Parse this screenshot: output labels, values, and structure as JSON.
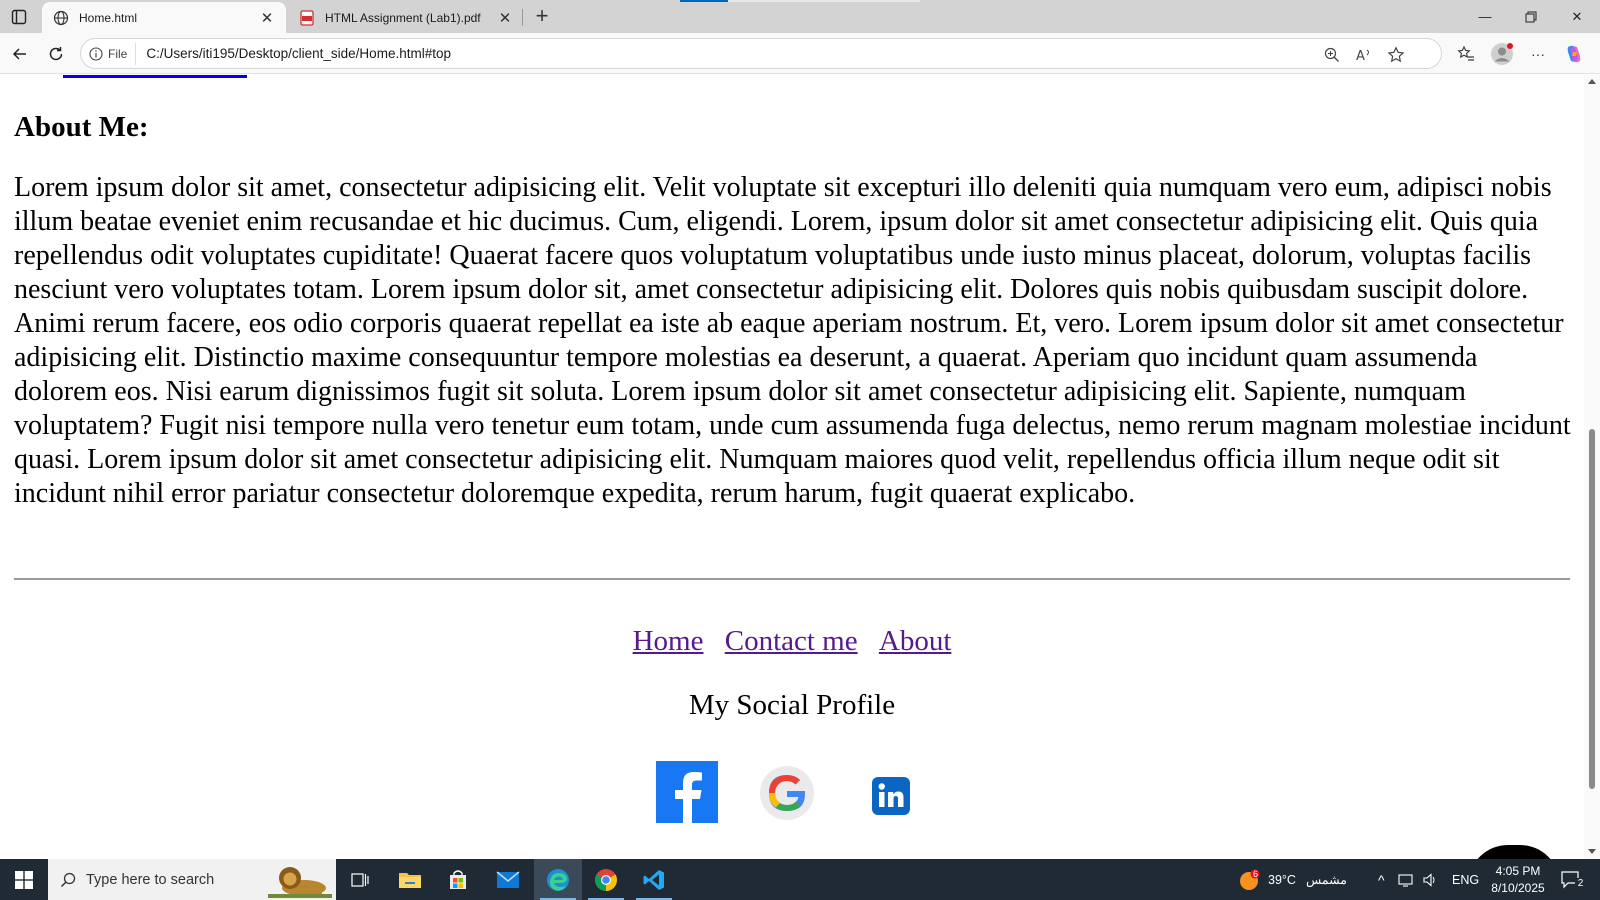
{
  "browser": {
    "tabs": [
      {
        "title": "Home.html",
        "active": true,
        "icon": "globe-icon"
      },
      {
        "title": "HTML Assignment (Lab1).pdf",
        "active": false,
        "icon": "pdf-icon"
      }
    ],
    "address": {
      "site_info_label": "File",
      "url": "C:/Users/iti195/Desktop/client_side/Home.html#top"
    },
    "accent_color": "#0067c0"
  },
  "page": {
    "about_heading": "About Me:",
    "about_body": "Lorem ipsum dolor sit amet, consectetur adipisicing elit. Velit voluptate sit excepturi illo deleniti quia numquam vero eum, adipisci nobis illum beatae eveniet enim recusandae et hic ducimus. Cum, eligendi. Lorem, ipsum dolor sit amet consectetur adipisicing elit. Quis quia repellendus odit voluptates cupiditate! Quaerat facere quos voluptatum voluptatibus unde iusto minus placeat, dolorum, voluptas facilis nesciunt vero voluptates totam. Lorem ipsum dolor sit, amet consectetur adipisicing elit. Dolores quis nobis quibusdam suscipit dolore. Animi rerum facere, eos odio corporis quaerat repellat ea iste ab eaque aperiam nostrum. Et, vero. Lorem ipsum dolor sit amet consectetur adipisicing elit. Distinctio maxime consequuntur tempore molestias ea deserunt, a quaerat. Aperiam quo incidunt quam assumenda dolorem eos. Nisi earum dignissimos fugit sit soluta. Lorem ipsum dolor sit amet consectetur adipisicing elit. Sapiente, numquam voluptatem? Fugit nisi tempore nulla vero tenetur eum totam, unde cum assumenda fuga delectus, nemo rerum magnam molestiae incidunt quasi. Lorem ipsum dolor sit amet consectetur adipisicing elit. Numquam maiores quod velit, repellendus officia illum neque odit sit incidunt nihil error pariatur consectetur doloremque expedita, rerum harum, fugit quaerat explicabo.",
    "footer_links": {
      "home": "Home",
      "contact": "Contact me",
      "about": "About"
    },
    "social_title": "My Social Profile",
    "social_icons": [
      "facebook-icon",
      "google-icon",
      "linkedin-icon"
    ],
    "link_color": "#551a8b"
  },
  "taskbar": {
    "search_placeholder": "Type here to search",
    "weather_temp": "39°C",
    "weather_desc": "مشمس",
    "weather_badge": "6",
    "language": "ENG",
    "time": "4:05 PM",
    "date": "8/10/2025",
    "notification_count": "2",
    "apps": [
      "task-view-icon",
      "file-explorer-icon",
      "store-icon",
      "mail-icon",
      "edge-icon",
      "chrome-icon",
      "vscode-icon"
    ]
  }
}
